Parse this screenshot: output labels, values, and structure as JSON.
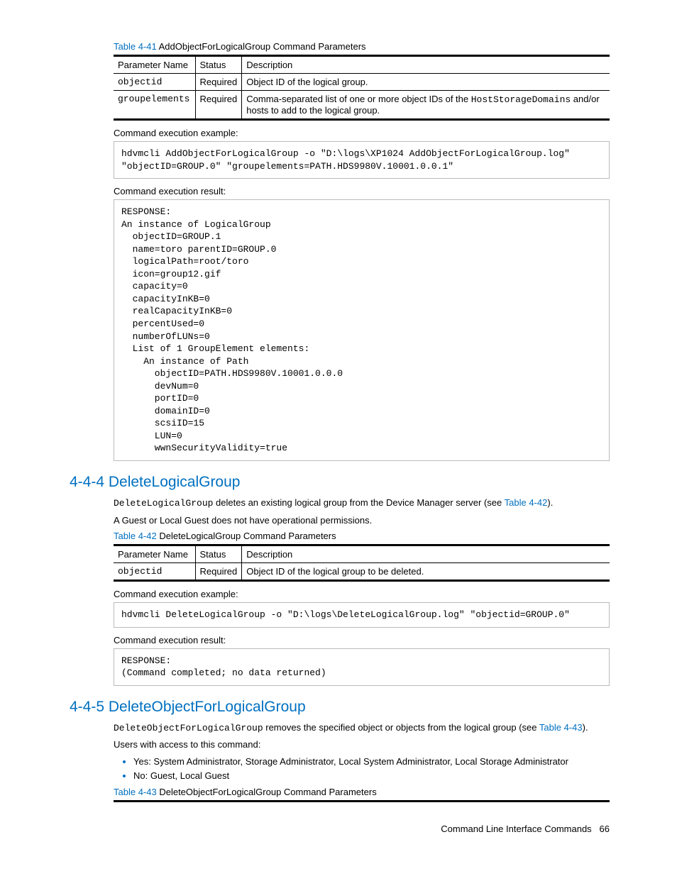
{
  "table41": {
    "caption_num": "Table 4-41",
    "caption_txt": "  AddObjectForLogicalGroup Command Parameters",
    "headers": {
      "c1": "Parameter Name",
      "c2": "Status",
      "c3": "Description"
    },
    "row1": {
      "c1": "objectid",
      "c2": "Required",
      "c3": "Object ID of the logical group."
    },
    "row2": {
      "c1": "groupelements",
      "c2": "Required",
      "c3_a": "Comma-separated list of one or more object IDs of the ",
      "c3_code": "HostStorageDomains",
      "c3_b": " and/or hosts to add to the logical group."
    }
  },
  "labels": {
    "exec_example": "Command execution example:",
    "exec_result": "Command execution result:"
  },
  "code1": "hdvmcli AddObjectForLogicalGroup -o \"D:\\logs\\XP1024 AddObjectForLogicalGroup.log\"\n\"objectID=GROUP.0\" \"groupelements=PATH.HDS9980V.10001.0.0.1\"",
  "code2": "RESPONSE:\nAn instance of LogicalGroup\n  objectID=GROUP.1\n  name=toro parentID=GROUP.0\n  logicalPath=root/toro\n  icon=group12.gif\n  capacity=0\n  capacityInKB=0\n  realCapacityInKB=0\n  percentUsed=0\n  numberOfLUNs=0\n  List of 1 GroupElement elements:\n    An instance of Path\n      objectID=PATH.HDS9980V.10001.0.0.0\n      devNum=0\n      portID=0\n      domainID=0\n      scsiID=15\n      LUN=0\n      wwnSecurityValidity=true",
  "sec444": {
    "title": "4-4-4 DeleteLogicalGroup",
    "p1_code": "DeleteLogicalGroup",
    "p1_txt": " deletes an existing logical group from the Device Manager server (see ",
    "p1_link": "Table 4-42",
    "p1_end": ").",
    "p2": "A Guest or Local Guest does not have operational permissions."
  },
  "table42": {
    "caption_num": "Table 4-42",
    "caption_txt": "  DeleteLogicalGroup Command Parameters",
    "headers": {
      "c1": "Parameter Name",
      "c2": "Status",
      "c3": "Description"
    },
    "row1": {
      "c1": "objectid",
      "c2": "Required",
      "c3": "Object ID of the logical group to be deleted."
    }
  },
  "code3": "hdvmcli DeleteLogicalGroup -o \"D:\\logs\\DeleteLogicalGroup.log\" \"objectid=GROUP.0\"",
  "code4": "RESPONSE:\n(Command completed; no data returned)",
  "sec445": {
    "title": "4-4-5 DeleteObjectForLogicalGroup",
    "p1_code": "DeleteObjectForLogicalGroup",
    "p1_txt": " removes the specified object or objects from the logical group (see ",
    "p1_link": "Table 4-43",
    "p1_end": ").",
    "p2": "Users with access to this command:",
    "li1": "Yes: System Administrator, Storage Administrator, Local System Administrator, Local Storage Administrator",
    "li2": "No: Guest, Local Guest"
  },
  "table43": {
    "caption_num": "Table 4-43",
    "caption_txt": "  DeleteObjectForLogicalGroup Command Parameters"
  },
  "footer": {
    "txt": "Command Line Interface Commands",
    "page": "66"
  }
}
